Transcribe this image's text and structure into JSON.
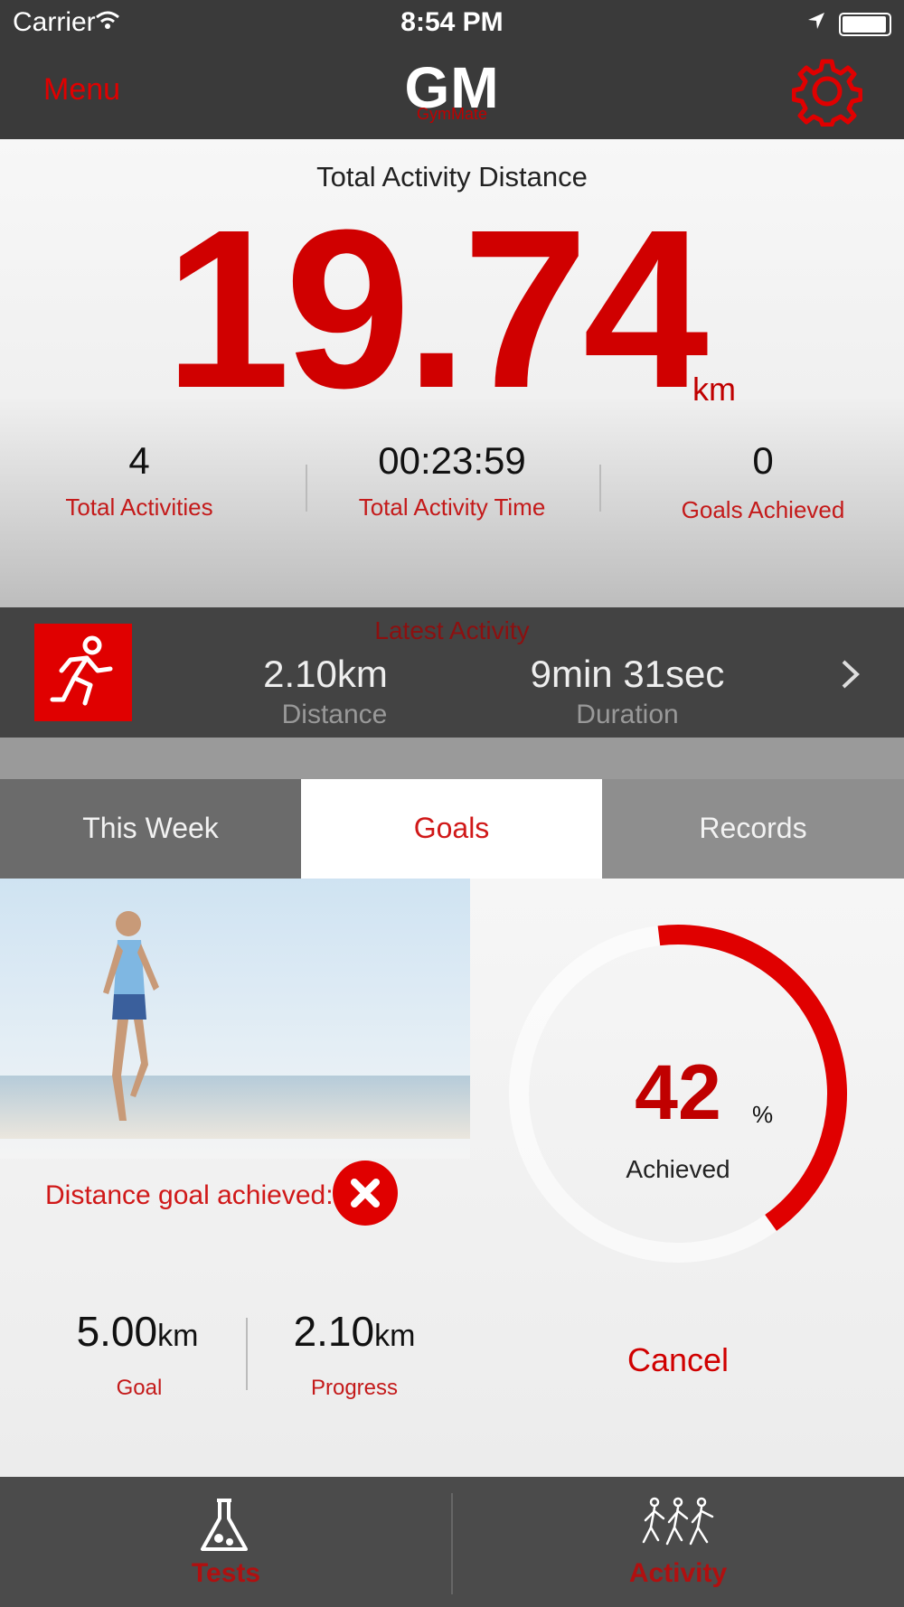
{
  "status_bar": {
    "carrier": "Carrier",
    "time": "8:54 PM"
  },
  "nav": {
    "menu_label": "Menu",
    "logo_text": "GM",
    "logo_subtitle": "GymMate",
    "settings_icon": "gear-icon"
  },
  "summary": {
    "title": "Total Activity Distance",
    "distance_value": "19.74",
    "distance_unit": "km",
    "stats": [
      {
        "value": "4",
        "label": "Total Activities"
      },
      {
        "value": "00:23:59",
        "label": "Total Activity Time"
      },
      {
        "value": "0",
        "label": "Goals Achieved"
      }
    ]
  },
  "latest_activity": {
    "title": "Latest Activity",
    "icon": "runner-icon",
    "distance_value": "2.10km",
    "distance_label": "Distance",
    "duration_value": "9min 31sec",
    "duration_label": "Duration"
  },
  "tabs": [
    {
      "label": "This Week",
      "selected": false
    },
    {
      "label": "Goals",
      "selected": true
    },
    {
      "label": "Records",
      "selected": false
    }
  ],
  "goals": {
    "distance_goal_label": "Distance goal achieved:",
    "distance_goal_status_icon": "x-circle-icon",
    "progress_percent": 42,
    "percent_value": "42",
    "percent_sign": "%",
    "achieved_label": "Achieved",
    "goal_value": "5.00",
    "goal_unit": "km",
    "goal_label": "Goal",
    "progress_value": "2.10",
    "progress_unit": "km",
    "progress_label": "Progress",
    "cancel_label": "Cancel"
  },
  "tab_bar": [
    {
      "label": "Tests",
      "icon": "flask-icon"
    },
    {
      "label": "Activity",
      "icon": "runners-icon"
    }
  ],
  "colors": {
    "accent": "#E00000",
    "dark": "#3A3A3A"
  }
}
